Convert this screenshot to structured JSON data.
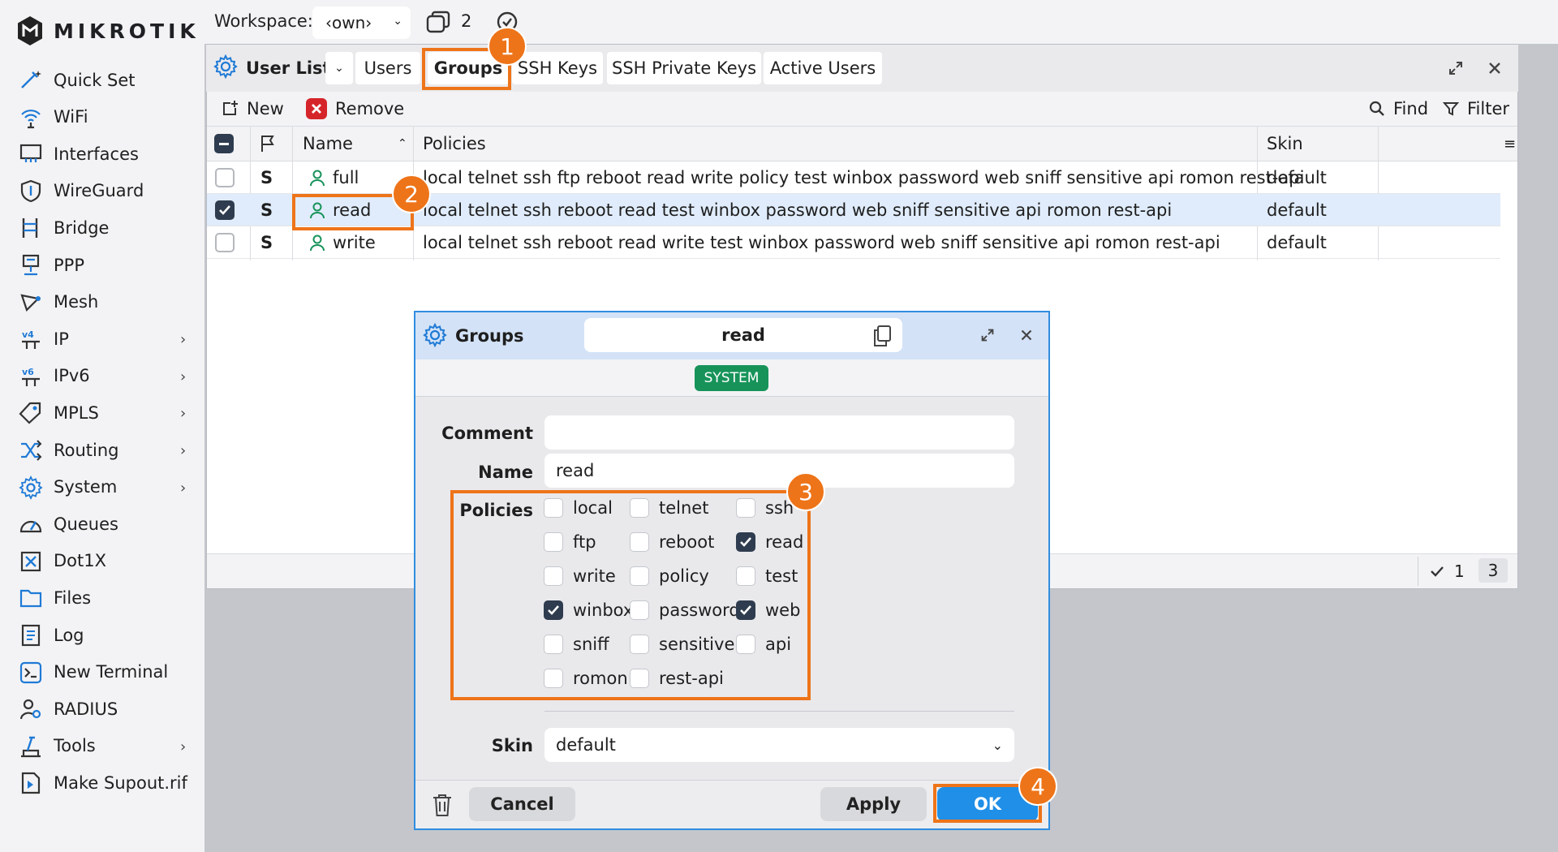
{
  "brand": {
    "name": "MIKROTIK"
  },
  "sidebar": {
    "items": [
      {
        "label": "Quick Set",
        "icon": "wand-icon",
        "submenu": false
      },
      {
        "label": "WiFi",
        "icon": "wifi-icon",
        "submenu": false
      },
      {
        "label": "Interfaces",
        "icon": "interfaces-icon",
        "submenu": false
      },
      {
        "label": "WireGuard",
        "icon": "wireguard-shield-icon",
        "submenu": false
      },
      {
        "label": "Bridge",
        "icon": "bridge-icon",
        "submenu": false
      },
      {
        "label": "PPP",
        "icon": "ppp-icon",
        "submenu": false
      },
      {
        "label": "Mesh",
        "icon": "mesh-icon",
        "submenu": false
      },
      {
        "label": "IP",
        "icon": "ip-icon",
        "submenu": true
      },
      {
        "label": "IPv6",
        "icon": "ipv6-icon",
        "submenu": true
      },
      {
        "label": "MPLS",
        "icon": "mpls-tag-icon",
        "submenu": true
      },
      {
        "label": "Routing",
        "icon": "routing-icon",
        "submenu": true
      },
      {
        "label": "System",
        "icon": "system-gear-icon",
        "submenu": true
      },
      {
        "label": "Queues",
        "icon": "queues-gauge-icon",
        "submenu": false
      },
      {
        "label": "Dot1X",
        "icon": "dot1x-icon",
        "submenu": false
      },
      {
        "label": "Files",
        "icon": "folder-icon",
        "submenu": false
      },
      {
        "label": "Log",
        "icon": "log-icon",
        "submenu": false
      },
      {
        "label": "New Terminal",
        "icon": "terminal-icon",
        "submenu": false
      },
      {
        "label": "RADIUS",
        "icon": "radius-icon",
        "submenu": false
      },
      {
        "label": "Tools",
        "icon": "tools-icon",
        "submenu": true
      },
      {
        "label": "Make Supout.rif",
        "icon": "supout-file-icon",
        "submenu": false
      }
    ]
  },
  "topbar": {
    "workspace_label": "Workspace:",
    "workspace_value": "‹own›",
    "window_count": "2"
  },
  "userlist": {
    "title": "User List",
    "tabs": [
      "Users",
      "Groups",
      "SSH Keys",
      "SSH Private Keys",
      "Active Users"
    ],
    "active_tab": "Groups",
    "toolbar": {
      "new": "New",
      "remove": "Remove",
      "find": "Find",
      "filter": "Filter"
    },
    "columns": [
      "Name",
      "Policies",
      "Skin"
    ],
    "rows": [
      {
        "flag": "S",
        "name": "full",
        "policies": "local telnet ssh ftp reboot read write policy test winbox password web sniff sensitive api romon rest-api",
        "skin": "default",
        "selected": false
      },
      {
        "flag": "S",
        "name": "read",
        "policies": "local telnet ssh reboot read test winbox password web sniff sensitive api romon rest-api",
        "skin": "default",
        "selected": true
      },
      {
        "flag": "S",
        "name": "write",
        "policies": "local telnet ssh reboot read write test winbox password web sniff sensitive api romon rest-api",
        "skin": "default",
        "selected": false
      }
    ],
    "status": {
      "selected": "1",
      "total": "3"
    }
  },
  "dialog": {
    "title": "Groups",
    "item_name": "read",
    "badge": "SYSTEM",
    "fields": {
      "comment_label": "Comment",
      "comment_value": "",
      "name_label": "Name",
      "name_value": "read",
      "policies_label": "Policies",
      "skin_label": "Skin",
      "skin_value": "default"
    },
    "policies": [
      {
        "name": "local",
        "checked": false
      },
      {
        "name": "telnet",
        "checked": false
      },
      {
        "name": "ssh",
        "checked": false
      },
      {
        "name": "ftp",
        "checked": false
      },
      {
        "name": "reboot",
        "checked": false
      },
      {
        "name": "read",
        "checked": true
      },
      {
        "name": "write",
        "checked": false
      },
      {
        "name": "policy",
        "checked": false
      },
      {
        "name": "test",
        "checked": false
      },
      {
        "name": "winbox",
        "checked": true
      },
      {
        "name": "password",
        "checked": false
      },
      {
        "name": "web",
        "checked": true
      },
      {
        "name": "sniff",
        "checked": false
      },
      {
        "name": "sensitive",
        "checked": false
      },
      {
        "name": "api",
        "checked": false
      },
      {
        "name": "romon",
        "checked": false
      },
      {
        "name": "rest-api",
        "checked": false
      }
    ],
    "buttons": {
      "cancel": "Cancel",
      "apply": "Apply",
      "ok": "OK"
    }
  },
  "annotations": {
    "step1": "1",
    "step2": "2",
    "step3": "3",
    "step4": "4"
  },
  "colors": {
    "accent_annotation": "#ee7419",
    "ok_button": "#1f8fe8",
    "system_badge": "#17935a",
    "selected_row": "#e0ecfb"
  }
}
